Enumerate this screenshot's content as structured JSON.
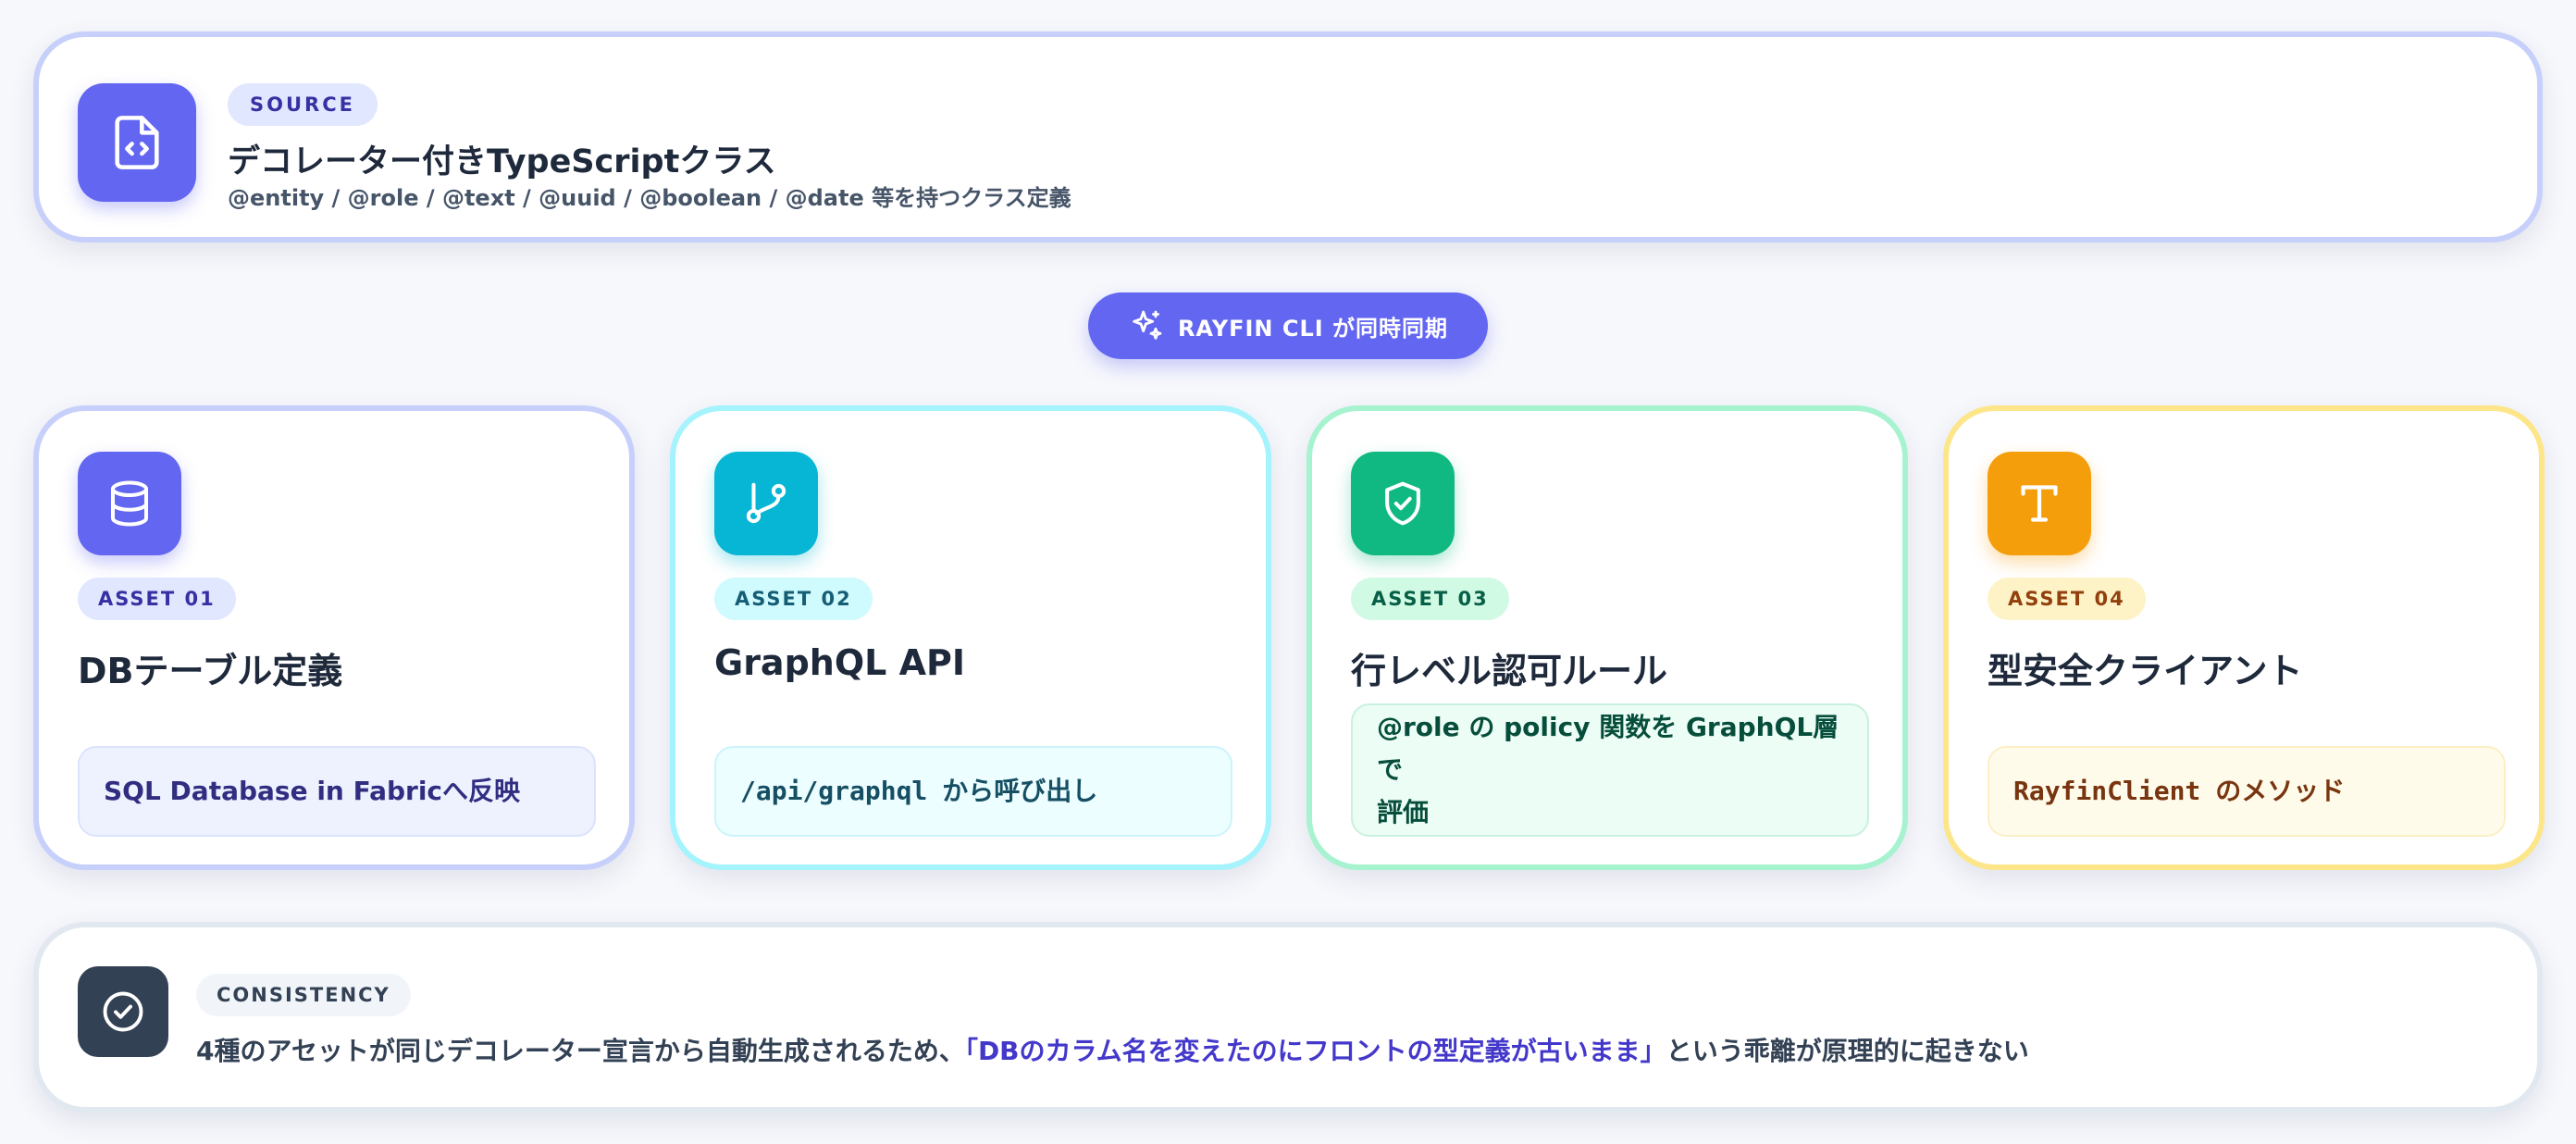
{
  "source": {
    "icon": "file-code-icon",
    "badge": "SOURCE",
    "title": "デコレーター付きTypeScriptクラス",
    "subtitle": "@entity / @role / @text / @uuid / @boolean / @date 等を持つクラス定義"
  },
  "cli": {
    "icon": "sparkles-icon",
    "label": "RAYFIN CLI が同時同期"
  },
  "assets": [
    {
      "icon": "database-icon",
      "badge": "ASSET 01",
      "title": "DBテーブル定義",
      "detail": "SQL Database in Fabricへ反映",
      "accent": "#6366f1"
    },
    {
      "icon": "git-branch-icon",
      "badge": "ASSET 02",
      "title": "GraphQL API",
      "detail_code": "/api/graphql",
      "detail": "から呼び出し",
      "accent": "#06b6d4"
    },
    {
      "icon": "shield-check-icon",
      "badge": "ASSET 03",
      "title": "行レベル認可ルール",
      "detail_line1": "@role の policy 関数を GraphQL層で",
      "detail_line2": "評価",
      "accent": "#10b981"
    },
    {
      "icon": "type-icon",
      "badge": "ASSET 04",
      "title": "型安全クライアント",
      "detail_code": "RayfinClient",
      "detail": "のメソッド",
      "accent": "#f59e0b"
    }
  ],
  "consistency": {
    "icon": "check-circle-icon",
    "badge": "CONSISTENCY",
    "text_before": "4種のアセットが同じデコレーター宣言から自動生成されるため、",
    "text_highlight": "「DBのカラム名を変えたのにフロントの型定義が古いまま」",
    "text_after": "という乖離が原理的に起きない"
  }
}
